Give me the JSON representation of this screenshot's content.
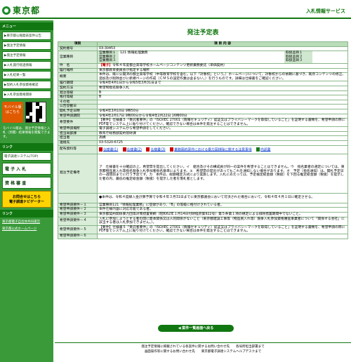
{
  "header": {
    "logo": "東京都",
    "site_title": "入札情報サービス"
  },
  "sidebar": {
    "menu_head": "メニュー",
    "items": [
      "▶東京都公報発表案件公告",
      "▶発注予定情報",
      "▶発注予定情報",
      "▶入札発行経過情報",
      "▶入札結果一覧",
      "▶契約入札参加資格確認",
      "▶入札参加資格関係"
    ],
    "mobile_label": "モバイル版",
    "mobile_sub": "はこちら",
    "note": "モバイル版は、発注予定情報と入札（見積）結果情報を閲覧できます。",
    "links_head": "リンク",
    "links": [
      "電子調達システム(TOP)"
    ],
    "btn_denshi": "電 子 入 札",
    "btn_shikaku": "資 格 審 査",
    "yellow": "お問合せはこちら",
    "yellow_sub": "電子調達ナビゲーター",
    "bottom_head": "リンク",
    "bottom_links": [
      "東京都電子自治体共同運営",
      "東京都公式ホームページ"
    ]
  },
  "main": {
    "title": "発注予定表",
    "head_left": "項目",
    "head_right": "項 目 内 容",
    "rows": [
      {
        "label": "契約番号",
        "value": "03-30453"
      },
      {
        "label": "営業種目",
        "sub": [
          [
            "営業種目１",
            "121 情報処理業務",
            "取扱品目１",
            ""
          ],
          [
            "営業種目２",
            "",
            "取扱品目２",
            ""
          ],
          [
            "営業種目３",
            "",
            "取扱品目３",
            ""
          ]
        ]
      },
      {
        "label": "件　名",
        "tag": "【電子】",
        "value": "令和４年度都立高等学校ホームページコンテンツ更新業務委託（単価契約）"
      },
      {
        "label": "履行場所",
        "value": "東京都教育委員会が指定する場所"
      },
      {
        "label": "概要",
        "value": "本件は、既に公開済の都立高等学校（中等教育学校を含む。以下「対象校」という。）ホームページについて、対象校からの依頼に基づき、既存コンテンツの修正、追加及び削除並びに新規ページの作成（ＣＭＳの設定作業は含まない。）を行うものです。詳細は仕様書をご確認ください。"
      },
      {
        "label": "履行期間",
        "value": "令和4年4月1日から令和5年3月31日まで"
      },
      {
        "label": "契約方法",
        "value": "希望制指名競争入札"
      },
      {
        "label": "発注等級",
        "value": "B"
      },
      {
        "label": "格付等級",
        "value": "B"
      },
      {
        "label": "その他",
        "value": ""
      },
      {
        "label": "公告登載日",
        "value": ""
      },
      {
        "label": "開札予定日時",
        "value": "令和4年3月10日 9時50分"
      },
      {
        "label": "希望申請期間",
        "value": "令和4年2月17日 9時00分から令和4年2月22日 16時00分"
      },
      {
        "label": "希望要件",
        "value": "【要件】仕様書５「受託者要件」の「ISO/IEC 27001（情報セキュリティ）認証又はプライバシーマークを取得していること」を証明する書類を、希望申請の際にPDF等でシステム上に貼り付けてください。確認できない場合は本件を発注することはできません。"
      },
      {
        "label": "希望申請場所",
        "value": "電子調達システムから希望申請をしてください。"
      },
      {
        "label": "担当局部課",
        "value": "教育庁総務部契約管財課"
      },
      {
        "label": "担当者",
        "value": "高橋"
      },
      {
        "label": "連絡先",
        "value": "03-5320-6725"
      },
      {
        "label": "配布資料等",
        "files": [
          "仕様書(1)",
          "仕様書(2)",
          "仕様書(3)",
          "業務契約案件における暴力団排除に関する注意事項",
          "内訳書"
        ]
      },
      {
        "label": "発注予定備考",
        "value": "ア　仕様書を十分確認の上、希望票を提出してください。イ　組合及びその構成員が同一の案件を希望することはできません。ウ　指名業者の選定については、東京都物品買入れ等指名競争入札参加者指名基準によります。エ　希望票の提出があってもこれを通知しない場合があります。オ　予定（指名通知）は、開札予定日の一週間前までに行う予定です。カ　本件は、総額確定方式により実施します。入札にあたっては、予定検定総金額（税抜）を下回る推定総金額（税抜）を提示した者の内、最低の推定総金額（税抜）を提示した者を落札者とします。"
      },
      {
        "label": "",
        "value": "●本件は、令和４度繰入金計算予算で令和４年３月31日までに東京都議会において可決された場合において、令和４年４月１日に確定させる。"
      },
      {
        "label": "希望申請要件－１",
        "value": "営業種目121「情報処理業務」に登録があり、「B」の等級に格付けされている者。"
      },
      {
        "label": "希望申請要件－２",
        "value": "本件仕様内容に対応可能である者。"
      },
      {
        "label": "希望申請要件－３",
        "value": "東京都契約関係暴力団等対策措置要綱（昭和62年１月14日付財経庶第922号）第５条第１項の規定による排除措置期間中でないこと。"
      },
      {
        "label": "希望申請要件－４",
        "value": "入札に参加しようとする者の間に資本関係又は人的関係がないこと（東京都建設工事等（物品買入れ等）競争入札参加資格審査事業者について「関係する会社」に該当する者は入札参加できません。）。"
      },
      {
        "label": "希望申請要件－５",
        "value": "【要件】仕様書５「受託者要件」の「ISO/IEC 27001（情報セキュリティ）認証又はプライバシーマークを取得していること」を証明する書類を、希望申請の際にPDF等でシステム上に貼り付けてください。確認できない場合は本件を発注することはできません。"
      },
      {
        "label": "希望申請要件－６",
        "value": ""
      }
    ],
    "back_button": "◀ 案件一覧画面へ戻る"
  },
  "footer": {
    "line1": "発注予定情報に掲載されている各案件に関するお問い合わせ先　　各局所担当部署まで",
    "line2": "画面操作等に関するお問い合わせ先　　東京都電子調達システムヘルプデスクまで"
  }
}
